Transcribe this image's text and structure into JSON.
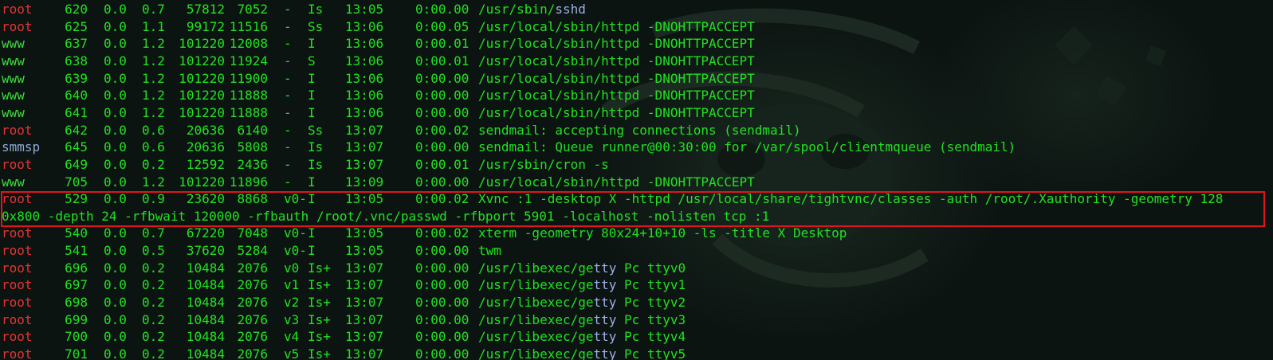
{
  "terminal": {
    "rows": [
      {
        "user": "root",
        "ucls": "u-root",
        "pid": "620",
        "cpu": "0.0",
        "mem": "0.7",
        "vsz": "57812",
        "rss": "7052",
        "tt": "-",
        "stat": "Is",
        "started": "13:05",
        "time": "0:00.00",
        "cmd_pre": "/usr/sbin/",
        "cmd_blue": "sshd",
        "cmd_post": ""
      },
      {
        "user": "root",
        "ucls": "u-root",
        "pid": "625",
        "cpu": "0.0",
        "mem": "1.1",
        "vsz": "99172",
        "rss": "11516",
        "tt": "-",
        "stat": "Ss",
        "started": "13:06",
        "time": "0:00.05",
        "cmd_pre": "/usr/local/sbin/httpd -DNOHTTPACCEPT",
        "cmd_blue": "",
        "cmd_post": ""
      },
      {
        "user": "www",
        "ucls": "u-www",
        "pid": "637",
        "cpu": "0.0",
        "mem": "1.2",
        "vsz": "101220",
        "rss": "12008",
        "tt": "-",
        "stat": "I",
        "started": "13:06",
        "time": "0:00.01",
        "cmd_pre": "/usr/local/sbin/httpd -DNOHTTPACCEPT",
        "cmd_blue": "",
        "cmd_post": ""
      },
      {
        "user": "www",
        "ucls": "u-www",
        "pid": "638",
        "cpu": "0.0",
        "mem": "1.2",
        "vsz": "101220",
        "rss": "11924",
        "tt": "-",
        "stat": "S",
        "started": "13:06",
        "time": "0:00.01",
        "cmd_pre": "/usr/local/sbin/httpd -DNOHTTPACCEPT",
        "cmd_blue": "",
        "cmd_post": ""
      },
      {
        "user": "www",
        "ucls": "u-www",
        "pid": "639",
        "cpu": "0.0",
        "mem": "1.2",
        "vsz": "101220",
        "rss": "11900",
        "tt": "-",
        "stat": "I",
        "started": "13:06",
        "time": "0:00.00",
        "cmd_pre": "/usr/local/sbin/httpd -DNOHTTPACCEPT",
        "cmd_blue": "",
        "cmd_post": ""
      },
      {
        "user": "www",
        "ucls": "u-www",
        "pid": "640",
        "cpu": "0.0",
        "mem": "1.2",
        "vsz": "101220",
        "rss": "11888",
        "tt": "-",
        "stat": "I",
        "started": "13:06",
        "time": "0:00.00",
        "cmd_pre": "/usr/local/sbin/httpd -DNOHTTPACCEPT",
        "cmd_blue": "",
        "cmd_post": ""
      },
      {
        "user": "www",
        "ucls": "u-www",
        "pid": "641",
        "cpu": "0.0",
        "mem": "1.2",
        "vsz": "101220",
        "rss": "11888",
        "tt": "-",
        "stat": "I",
        "started": "13:06",
        "time": "0:00.00",
        "cmd_pre": "/usr/local/sbin/httpd -DNOHTTPACCEPT",
        "cmd_blue": "",
        "cmd_post": ""
      },
      {
        "user": "root",
        "ucls": "u-root",
        "pid": "642",
        "cpu": "0.0",
        "mem": "0.6",
        "vsz": "20636",
        "rss": "6140",
        "tt": "-",
        "stat": "Ss",
        "started": "13:07",
        "time": "0:00.02",
        "cmd_pre": "sendmail: accepting connections (sendmail)",
        "cmd_blue": "",
        "cmd_post": ""
      },
      {
        "user": "smmsp",
        "ucls": "u-smmsp",
        "pid": "645",
        "cpu": "0.0",
        "mem": "0.6",
        "vsz": "20636",
        "rss": "5808",
        "tt": "-",
        "stat": "Is",
        "started": "13:07",
        "time": "0:00.00",
        "cmd_pre": "sendmail: Queue runner@00:30:00 for /var/spool/clientmqueue (sendmail)",
        "cmd_blue": "",
        "cmd_post": ""
      },
      {
        "user": "root",
        "ucls": "u-root",
        "pid": "649",
        "cpu": "0.0",
        "mem": "0.2",
        "vsz": "12592",
        "rss": "2436",
        "tt": "-",
        "stat": "Is",
        "started": "13:07",
        "time": "0:00.01",
        "cmd_pre": "/usr/sbin/cron -s",
        "cmd_blue": "",
        "cmd_post": ""
      },
      {
        "user": "www",
        "ucls": "u-www",
        "pid": "705",
        "cpu": "0.0",
        "mem": "1.2",
        "vsz": "101220",
        "rss": "11896",
        "tt": "-",
        "stat": "I",
        "started": "13:09",
        "time": "0:00.00",
        "cmd_pre": "/usr/local/sbin/httpd -DNOHTTPACCEPT",
        "cmd_blue": "",
        "cmd_post": ""
      },
      {
        "user": "root",
        "ucls": "u-root",
        "pid": "529",
        "cpu": "0.0",
        "mem": "0.9",
        "vsz": "23620",
        "rss": "8868",
        "tt": "v0-",
        "stat": "I",
        "started": "13:05",
        "time": "0:00.02",
        "cmd_pre": "Xvnc :1 -desktop X -httpd /usr/local/share/tightvnc/classes -auth /root/.Xauthority -geometry 128",
        "cmd_blue": "",
        "cmd_post": ""
      },
      {
        "user": "root",
        "ucls": "u-root",
        "pid": "540",
        "cpu": "0.0",
        "mem": "0.7",
        "vsz": "67220",
        "rss": "7048",
        "tt": "v0-",
        "stat": "I",
        "started": "13:05",
        "time": "0:00.02",
        "cmd_pre": "xterm -geometry 80x24+10+10 -ls -title X Desktop",
        "cmd_blue": "",
        "cmd_post": ""
      },
      {
        "user": "root",
        "ucls": "u-root",
        "pid": "541",
        "cpu": "0.0",
        "mem": "0.5",
        "vsz": "37620",
        "rss": "5284",
        "tt": "v0-",
        "stat": "I",
        "started": "13:05",
        "time": "0:00.00",
        "cmd_pre": "twm",
        "cmd_blue": "",
        "cmd_post": ""
      },
      {
        "user": "root",
        "ucls": "u-root",
        "pid": "696",
        "cpu": "0.0",
        "mem": "0.2",
        "vsz": "10484",
        "rss": "2076",
        "tt": "v0",
        "stat": "Is+",
        "started": "13:07",
        "time": "0:00.00",
        "cmd_pre": "/usr/libexec/ge",
        "cmd_blue": "tty",
        "cmd_post": " Pc ttyv0"
      },
      {
        "user": "root",
        "ucls": "u-root",
        "pid": "697",
        "cpu": "0.0",
        "mem": "0.2",
        "vsz": "10484",
        "rss": "2076",
        "tt": "v1",
        "stat": "Is+",
        "started": "13:07",
        "time": "0:00.00",
        "cmd_pre": "/usr/libexec/ge",
        "cmd_blue": "tty",
        "cmd_post": " Pc ttyv1"
      },
      {
        "user": "root",
        "ucls": "u-root",
        "pid": "698",
        "cpu": "0.0",
        "mem": "0.2",
        "vsz": "10484",
        "rss": "2076",
        "tt": "v2",
        "stat": "Is+",
        "started": "13:07",
        "time": "0:00.00",
        "cmd_pre": "/usr/libexec/ge",
        "cmd_blue": "tty",
        "cmd_post": " Pc ttyv2"
      },
      {
        "user": "root",
        "ucls": "u-root",
        "pid": "699",
        "cpu": "0.0",
        "mem": "0.2",
        "vsz": "10484",
        "rss": "2076",
        "tt": "v3",
        "stat": "Is+",
        "started": "13:07",
        "time": "0:00.00",
        "cmd_pre": "/usr/libexec/ge",
        "cmd_blue": "tty",
        "cmd_post": " Pc ttyv3"
      },
      {
        "user": "root",
        "ucls": "u-root",
        "pid": "700",
        "cpu": "0.0",
        "mem": "0.2",
        "vsz": "10484",
        "rss": "2076",
        "tt": "v4",
        "stat": "Is+",
        "started": "13:07",
        "time": "0:00.00",
        "cmd_pre": "/usr/libexec/ge",
        "cmd_blue": "tty",
        "cmd_post": " Pc ttyv4"
      },
      {
        "user": "root",
        "ucls": "u-root",
        "pid": "701",
        "cpu": "0.0",
        "mem": "0.2",
        "vsz": "10484",
        "rss": "2076",
        "tt": "v5",
        "stat": "Is+",
        "started": "13:07",
        "time": "0:00.00",
        "cmd_pre": "/usr/libexec/ge",
        "cmd_blue": "tty",
        "cmd_post": " Pc ttyv5"
      }
    ],
    "wrapped_line": "0x800 -depth 24 -rfbwait 120000 -rfbauth /root/.vnc/passwd -rfbport 5901 -localhost -nolisten tcp :1"
  },
  "colors": {
    "root": "#e23434",
    "www": "#3cdc3c",
    "smmsp": "#8fa8d8",
    "command": "#22e022",
    "highlight_border": "#e0151b",
    "background": "#0c1411"
  },
  "background_icon": "mascot-watermark-icon"
}
